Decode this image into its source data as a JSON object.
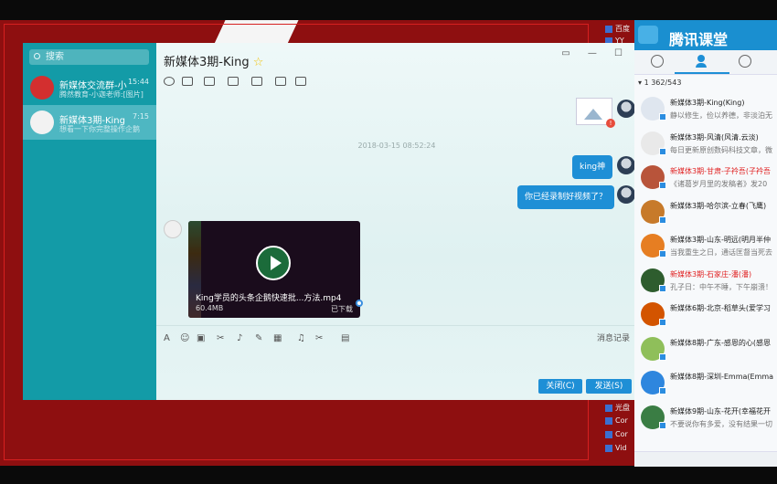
{
  "search": {
    "placeholder": "搜索"
  },
  "conversations": [
    {
      "name": "新媒体交流群-小",
      "time": "15:44",
      "preview": "腾然教育-小迦老师:[图片]"
    },
    {
      "name": "新媒体3期-King",
      "time": "7:15",
      "preview": "想看一下你完整操作企鹅"
    }
  ],
  "chat": {
    "title": "新媒体3期-King",
    "star": "☆",
    "timestamp": "2018-03-15 08:52:24",
    "messages": [
      {
        "text": "king神"
      },
      {
        "text": "你已经录制好视频了？"
      }
    ],
    "video": {
      "filename": "King学员的头条企鹅快速批...方法.mp4",
      "size": "60.4MB",
      "action": "已下载"
    },
    "msg_record": "消息记录",
    "close_label": "关闭(C)",
    "send_label": "发送(S)"
  },
  "right_panel": {
    "brand": "腾讯课堂",
    "count": "1 362/543",
    "members": [
      {
        "name": "新媒体3期-King(King)",
        "status": "静以修生，俭以养德，非淡泊无",
        "red": false,
        "color": "#dfe6ef"
      },
      {
        "name": "新媒体3期-风清(风清.云淡)",
        "status": "每日更新原创数码科技文章，微",
        "red": false,
        "color": "#e9e9e9"
      },
      {
        "name": "新媒体3期-甘肃-子衿吾(子衿吾",
        "status": "《诸葛岁月里的发稿者》发20",
        "red": true,
        "color": "#b8543a"
      },
      {
        "name": "新媒体3期-哈尔滨-立春(飞鹰)",
        "status": "",
        "red": false,
        "color": "#c77a2a"
      },
      {
        "name": "新媒体3期-山东-明远(明月半仲",
        "status": "当我重生之日，通话匡督当死去",
        "red": false,
        "color": "#e67e22"
      },
      {
        "name": "新媒体3期-石家庄-潘(潘)",
        "status": "孔子日：中午不睡，下午崩溃！",
        "red": true,
        "color": "#2e5d2e"
      },
      {
        "name": "新媒体6期-北京-稻草头(爱学习",
        "status": "",
        "red": false,
        "color": "#d35400"
      },
      {
        "name": "新媒体8期-广东-感恩的心(感恩",
        "status": "",
        "red": false,
        "color": "#8fbf5a"
      },
      {
        "name": "新媒体8期-深圳-Emma(Emma",
        "status": "",
        "red": false,
        "color": "#2e86de"
      },
      {
        "name": "新媒体9期-山东-花开(幸福花开",
        "status": "不要说你有多爱，没有结果一切",
        "red": false,
        "color": "#3a7d44"
      }
    ]
  },
  "taskbar": [
    "百度",
    "YY",
    "光盘",
    "Cor",
    "Cor",
    "Vid"
  ],
  "colors": {
    "sidebar": "#139ba7",
    "accent": "#1e8fd6",
    "desktop": "#8e0f10"
  }
}
